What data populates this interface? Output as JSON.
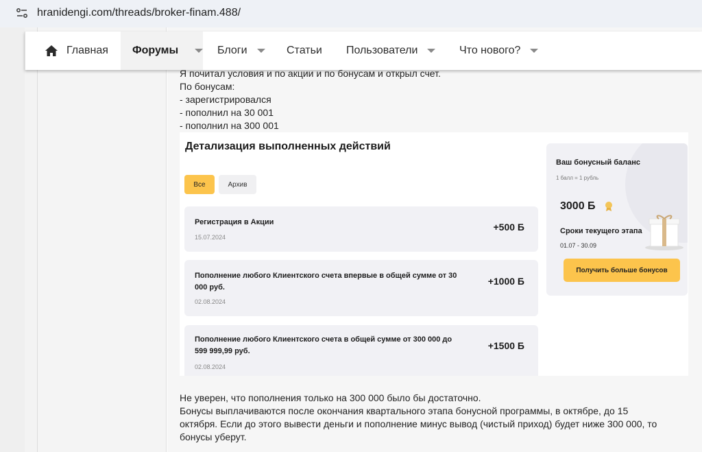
{
  "browser": {
    "url": "hranidengi.com/threads/broker-finam.488/"
  },
  "nav": {
    "home": "Главная",
    "forums": "Форумы",
    "blogs": "Блоги",
    "articles": "Статьи",
    "users": "Пользователи",
    "whats_new": "Что нового?"
  },
  "post": {
    "lines_top": [
      "Я почитал условия и по акции и по бонусам и открыл счет.",
      "По бонусам:",
      "- зарегистрировался",
      "- пополнил на 30 001",
      "- пополнил на 300 001"
    ],
    "lines_bottom": [
      "Не уверен, что пополнения только на 300 000 было бы достаточно.",
      "Бонусы выплачиваются после окончания квартального этапа бонусной программы, в октябре, до 15",
      "октября. Если до этого вывести деньги и пополнение минус вывод (чистый приход) будет ниже 300 000, то",
      "бонусы уберут."
    ]
  },
  "screenshot": {
    "title": "Детализация выполненных действий",
    "filters": {
      "all": "Все",
      "archive": "Архив"
    },
    "items": [
      {
        "title": "Регистрация в Акции",
        "date": "15.07.2024",
        "points": "+500 Б"
      },
      {
        "title": "Пополнение любого Клиентского счета впервые в общей сумме от 30 000 руб.",
        "date": "02.08.2024",
        "points": "+1000 Б"
      },
      {
        "title": "Пополнение любого Клиентского счета в общей сумме от 300 000 до 599 999,99 руб.",
        "date": "02.08.2024",
        "points": "+1500 Б"
      }
    ],
    "balance": {
      "title": "Ваш бонусный баланс",
      "rate": "1 балл = 1 рубль",
      "amount": "3000 Б",
      "term_label": "Сроки текущего этапа",
      "term_dates": "01.07 - 30.09",
      "button": "Получить больше бонусов"
    }
  },
  "colors": {
    "accent": "#fcc44c",
    "card_bg": "#f1f1f5"
  }
}
